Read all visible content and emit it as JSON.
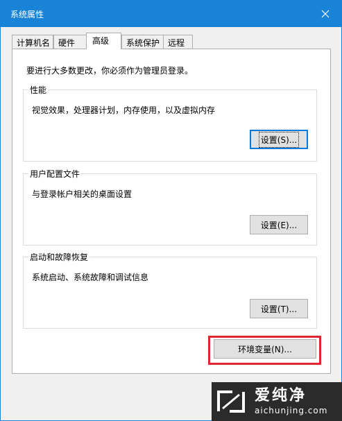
{
  "window": {
    "title": "系统属性"
  },
  "tabs": [
    {
      "label": "计算机名",
      "selected": false
    },
    {
      "label": "硬件",
      "selected": false
    },
    {
      "label": "高级",
      "selected": true
    },
    {
      "label": "系统保护",
      "selected": false
    },
    {
      "label": "远程",
      "selected": false
    }
  ],
  "notice": "要进行大多数更改，你必须作为管理员登录。",
  "performance": {
    "label": "性能",
    "description": "视觉效果，处理器计划，内存使用，以及虚拟内存",
    "button": "设置(S)..."
  },
  "user_profiles": {
    "label": "用户配置文件",
    "description": "与登录帐户相关的桌面设置",
    "button": "设置(E)..."
  },
  "startup_recovery": {
    "label": "启动和故障恢复",
    "description": "系统启动、系统故障和调试信息",
    "button": "设置(T)..."
  },
  "env_button": "环境变量(N)...",
  "watermark": {
    "name": "爱纯净",
    "url": "aichunjing.com"
  },
  "colors": {
    "accent": "#1883d7",
    "highlight": "#e2262f"
  }
}
